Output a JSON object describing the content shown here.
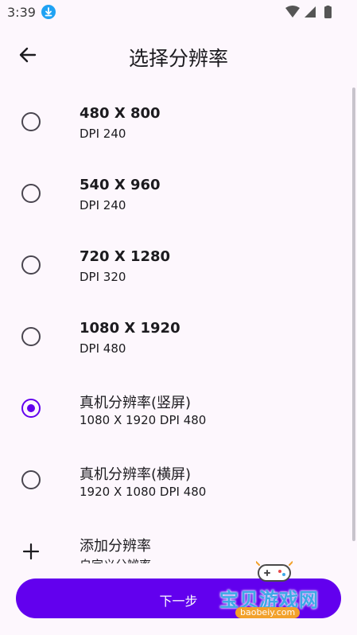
{
  "status_bar": {
    "time": "3:39"
  },
  "app_bar": {
    "title": "选择分辨率"
  },
  "resolutions": [
    {
      "label": "480 X 800",
      "sub": "DPI 240",
      "selected": false
    },
    {
      "label": "540 X 960",
      "sub": "DPI 240",
      "selected": false
    },
    {
      "label": "720 X 1280",
      "sub": "DPI 320",
      "selected": false
    },
    {
      "label": "1080 X 1920",
      "sub": "DPI 480",
      "selected": false
    },
    {
      "label": "真机分辨率(竖屏)",
      "sub": "1080 X 1920 DPI 480",
      "selected": true
    },
    {
      "label": "真机分辨率(横屏)",
      "sub": "1920 X 1080 DPI 480",
      "selected": false
    }
  ],
  "add_item": {
    "label": "添加分辨率",
    "sub": "自定义分辨率"
  },
  "next_button": {
    "label": "下一步"
  },
  "watermark": {
    "title": "宝贝游戏网",
    "url": "baobeiy.com"
  },
  "colors": {
    "accent": "#6200ee",
    "background": "#fdf7fd",
    "text": "#1c1b1f"
  }
}
